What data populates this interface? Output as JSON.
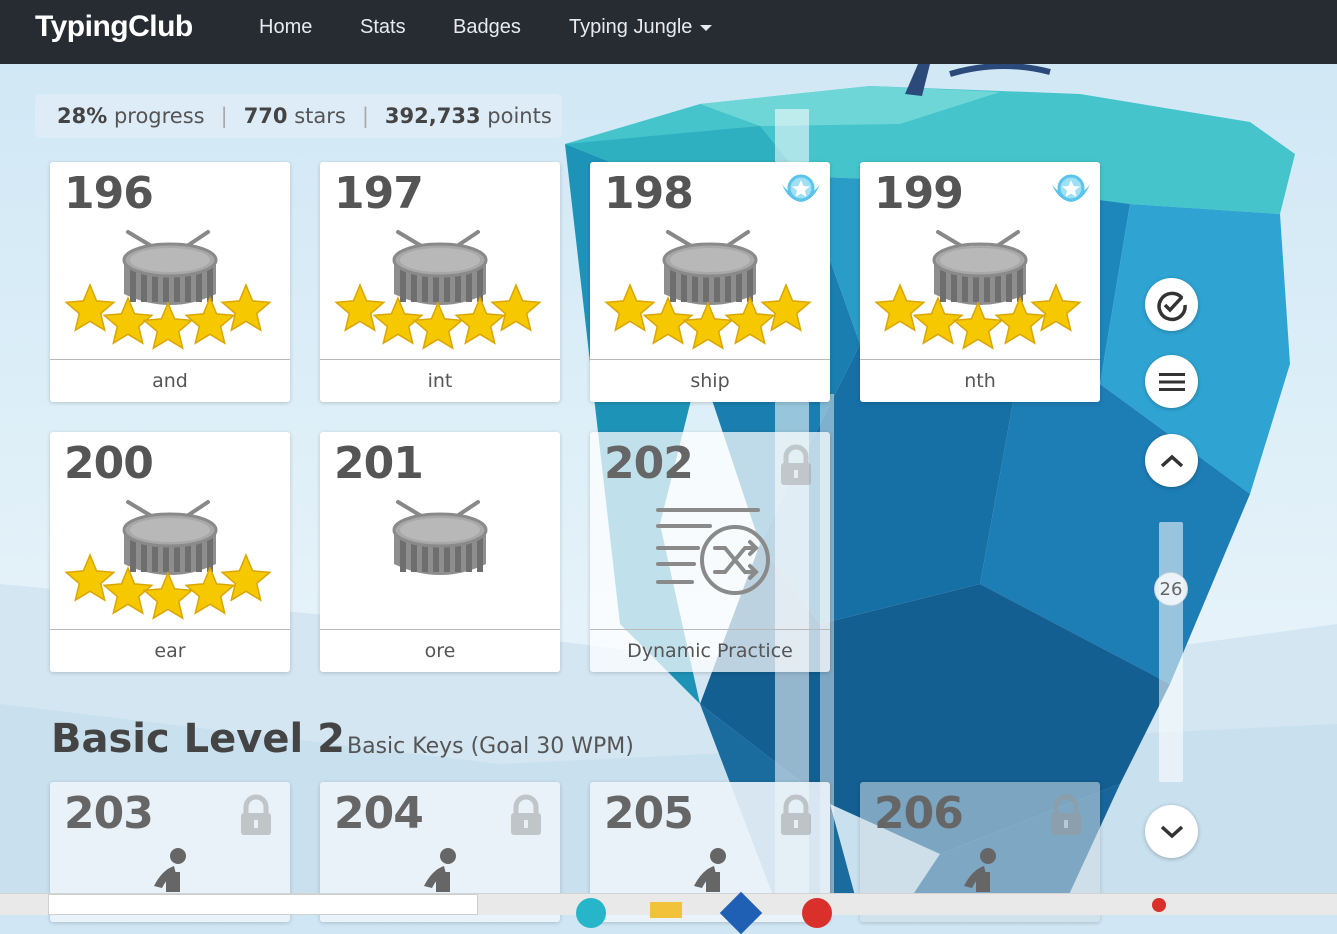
{
  "navbar": {
    "brand": "TypingClub",
    "items": [
      {
        "label": "Home"
      },
      {
        "label": "Stats"
      },
      {
        "label": "Badges"
      },
      {
        "label": "Typing Jungle",
        "has_dropdown": true
      }
    ]
  },
  "summary": {
    "progress_value": "28%",
    "progress_label": "progress",
    "stars_value": "770",
    "stars_label": "stars",
    "points_value": "392,733",
    "points_label": "points",
    "separator": "|"
  },
  "lessons": [
    {
      "number": "196",
      "label": "and",
      "stars": 5,
      "status": "completed",
      "badge": false,
      "icon": "drum-icon"
    },
    {
      "number": "197",
      "label": "int",
      "stars": 5,
      "status": "completed",
      "badge": false,
      "icon": "drum-icon"
    },
    {
      "number": "198",
      "label": "ship",
      "stars": 5,
      "status": "completed",
      "badge": true,
      "icon": "drum-icon"
    },
    {
      "number": "199",
      "label": "nth",
      "stars": 5,
      "status": "completed",
      "badge": true,
      "icon": "drum-icon"
    },
    {
      "number": "200",
      "label": "ear",
      "stars": 5,
      "status": "completed",
      "badge": false,
      "icon": "drum-icon"
    },
    {
      "number": "201",
      "label": "ore",
      "stars": 0,
      "status": "available",
      "badge": false,
      "icon": "drum-icon"
    },
    {
      "number": "202",
      "label": "Dynamic Practice",
      "stars": 0,
      "status": "locked",
      "badge": false,
      "icon": "shuffle-practice-icon"
    }
  ],
  "section": {
    "title": "Basic Level 2",
    "subtitle": "Basic Keys (Goal 30 WPM)"
  },
  "next_lessons": [
    {
      "number": "203",
      "status": "locked",
      "icon": "typist-icon"
    },
    {
      "number": "204",
      "status": "locked",
      "icon": "typist-icon"
    },
    {
      "number": "205",
      "status": "locked",
      "icon": "typist-icon"
    },
    {
      "number": "206",
      "status": "locked",
      "icon": "typist-icon"
    }
  ],
  "controls": {
    "slider_value": "26",
    "buttons": [
      "check-circle-icon",
      "menu-icon",
      "chevron-up-icon",
      "chevron-down-icon"
    ]
  },
  "colors": {
    "navbar": "#272c33",
    "star": "#f5c800",
    "badge": "#5cc3ea",
    "text": "#555555"
  }
}
